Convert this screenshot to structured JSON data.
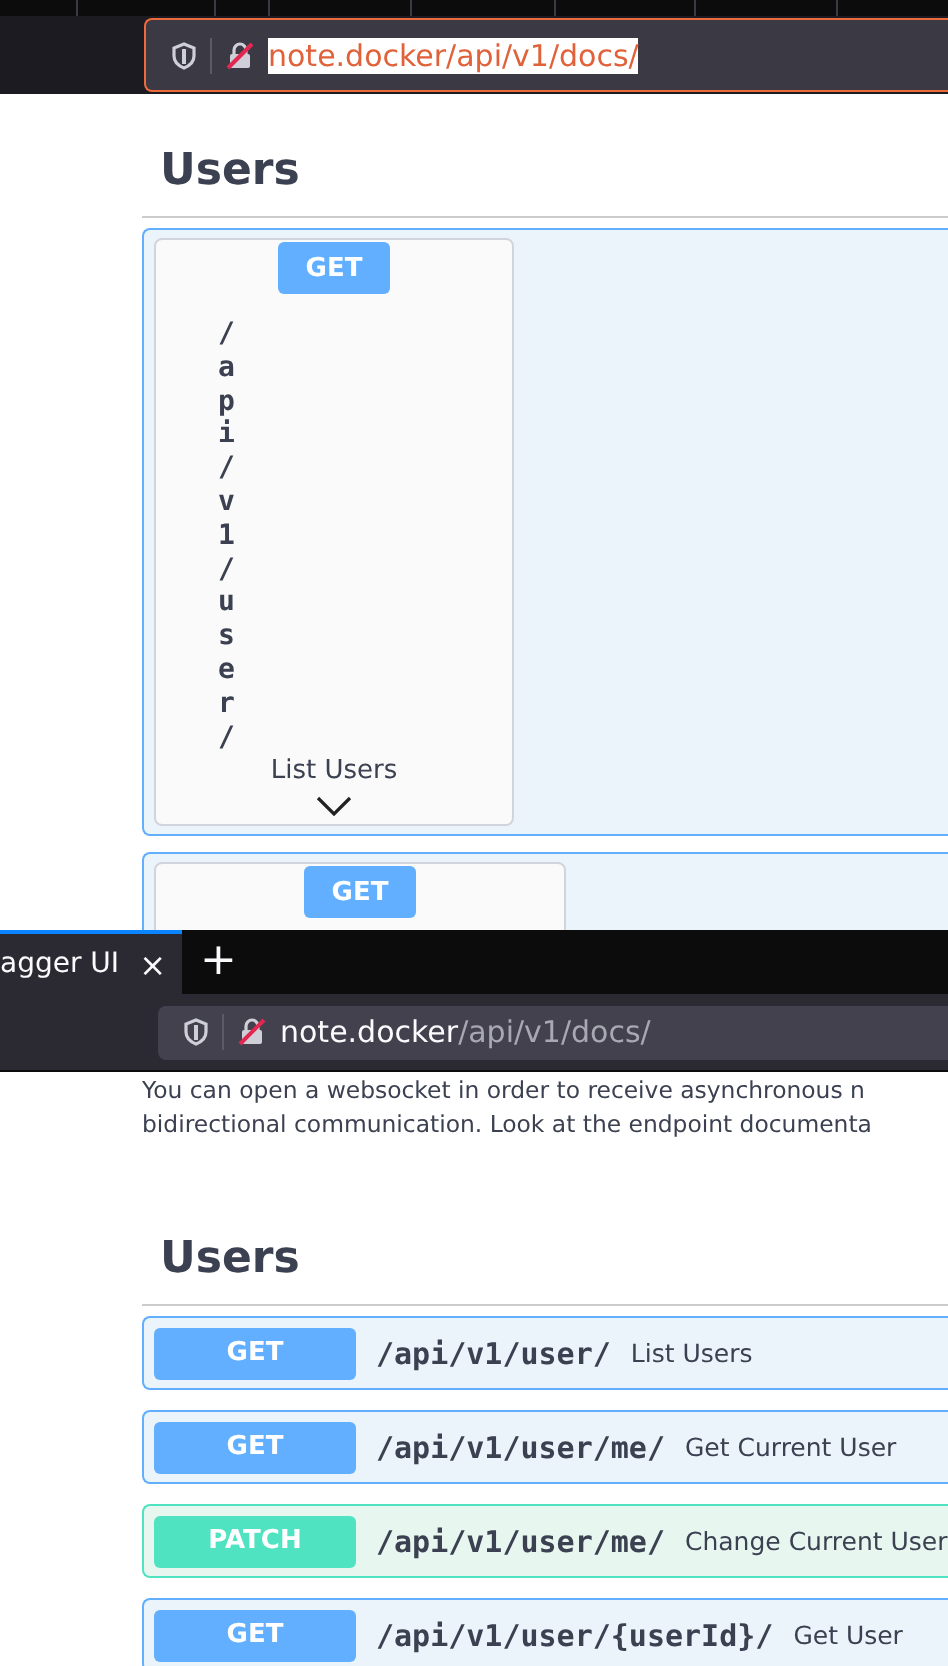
{
  "top": {
    "url": {
      "host": "note.docker",
      "path": "/api/v1/docs/",
      "focused": true
    },
    "section": "Users",
    "operations": [
      {
        "kind": "get",
        "method": "GET",
        "path": "/api/v1/user/",
        "summary": "List Users"
      },
      {
        "kind": "get",
        "method": "GET"
      }
    ]
  },
  "bottom": {
    "tab": {
      "title": "agger UI",
      "close": "×",
      "selected": true
    },
    "new_tab": "+",
    "url": {
      "host": "note.docker",
      "path": "/api/v1/docs/",
      "focused": false
    },
    "description": [
      "You can open a websocket in order to receive asynchronous n",
      "bidirectional communication. Look at the endpoint documenta"
    ],
    "section": "Users",
    "operations": [
      {
        "kind": "get",
        "method": "GET",
        "path": "/api/v1/user/",
        "summary": "List Users"
      },
      {
        "kind": "get",
        "method": "GET",
        "path": "/api/v1/user/me/",
        "summary": "Get Current User"
      },
      {
        "kind": "patch",
        "method": "PATCH",
        "path": "/api/v1/user/me/",
        "summary": "Change Current User"
      },
      {
        "kind": "get",
        "method": "GET",
        "path": "/api/v1/user/{userId}/",
        "summary": "Get User"
      }
    ]
  }
}
